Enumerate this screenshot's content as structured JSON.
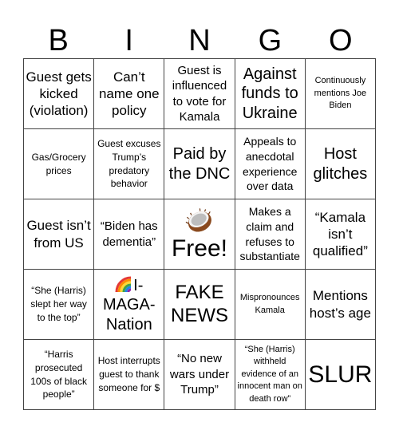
{
  "header": {
    "letters": [
      "B",
      "I",
      "N",
      "G",
      "O"
    ]
  },
  "board": {
    "rows": [
      [
        {
          "text": "Guest gets kicked (violation)",
          "size": "l"
        },
        {
          "text": "Can’t name one policy",
          "size": "l"
        },
        {
          "text": "Guest is influenced to vote for Kamala",
          "size": "ml"
        },
        {
          "text": "Against funds to Ukraine",
          "size": "xl"
        },
        {
          "text": "Continuously mentions Joe Biden",
          "size": "xs"
        }
      ],
      [
        {
          "text": "Gas/Grocery prices",
          "size": "s"
        },
        {
          "text": "Guest excuses Trump’s predatory behavior",
          "size": "s"
        },
        {
          "text": "Paid by the DNC",
          "size": "xl"
        },
        {
          "text": "Appeals to anecdotal experience over data",
          "size": "m"
        },
        {
          "text": "Host glitches",
          "size": "xl"
        }
      ],
      [
        {
          "text": "Guest isn’t from US",
          "size": "l"
        },
        {
          "text": "“Biden has dementia”",
          "size": "ml"
        },
        {
          "text": "Free!",
          "size": "free",
          "icon": "coconut-icon"
        },
        {
          "text": "Makes a claim and refuses to substantiate",
          "size": "m"
        },
        {
          "text": "“Kamala isn’t qualified”",
          "size": "l"
        }
      ],
      [
        {
          "text": "“She (Harris) slept her way to the top”",
          "size": "s"
        },
        {
          "text": "I-MAGA-Nation",
          "size": "xl",
          "icon": "rainbow-icon",
          "lines": [
            "I-",
            "MAGA-",
            "Nation"
          ]
        },
        {
          "text": "FAKE NEWS",
          "size": "xxl"
        },
        {
          "text": "Mispronounces Kamala",
          "size": "xs"
        },
        {
          "text": "Mentions host’s age",
          "size": "l"
        }
      ],
      [
        {
          "text": "“Harris prosecuted 100s of black people”",
          "size": "s"
        },
        {
          "text": "Host interrupts guest to thank someone for $",
          "size": "s"
        },
        {
          "text": "“No new wars under Trump”",
          "size": "ml"
        },
        {
          "text": "“She (Harris) withheld evidence of an innocent man on death row”",
          "size": "xs"
        },
        {
          "text": "SLUR",
          "size": "huge"
        }
      ]
    ]
  },
  "colors": {
    "grid_line": "#444444",
    "text": "#000000",
    "background": "#ffffff"
  }
}
